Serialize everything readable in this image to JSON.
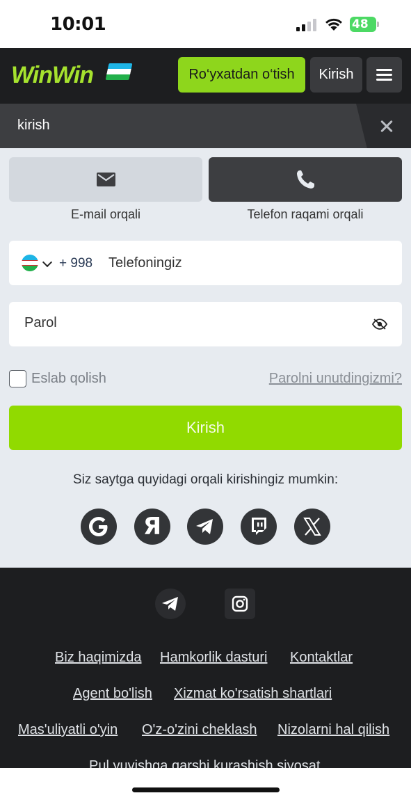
{
  "status_bar": {
    "time": "10:01",
    "battery": "48"
  },
  "header": {
    "logo_text": "WinWin",
    "register_label": "Ro‘yxatdan o‘tish",
    "login_label": "Kirish"
  },
  "modal": {
    "title": "kirish",
    "tabs": [
      {
        "label": "E-mail orqali",
        "icon": "envelope-icon"
      },
      {
        "label": "Telefon raqami orqali",
        "icon": "phone-icon"
      }
    ],
    "phone": {
      "dial_code": "+ 998",
      "placeholder": "Telefoningiz"
    },
    "password": {
      "placeholder": "Parol"
    },
    "remember_label": "Eslab qolish",
    "forgot_label": "Parolni unutdingizmi?",
    "submit_label": "Kirish",
    "social_caption": "Siz saytga quyidagi orqali kirishingiz mumkin:",
    "social_providers": [
      "google-icon",
      "yandex-icon",
      "telegram-icon",
      "twitch-icon",
      "x-icon"
    ],
    "yandex_letter": "Я"
  },
  "footer": {
    "social": [
      "telegram-icon",
      "instagram-icon"
    ],
    "links": [
      "Biz haqimizda",
      "Hamkorlik dasturi",
      "Kontaktlar",
      "Agent bo'lish",
      "Xizmat ko'rsatish shartlari",
      "Mas'uliyatli o'yin",
      "O'z-o'zini cheklash",
      "Nizolarni hal qilish",
      "Pul yuvishga qarshi kurashish siyosat"
    ]
  },
  "colors": {
    "accent_green": "#91da00",
    "header_bg": "#1d1e20",
    "tab_active": "#3d3e41",
    "page_bg": "#e7ebf0"
  }
}
